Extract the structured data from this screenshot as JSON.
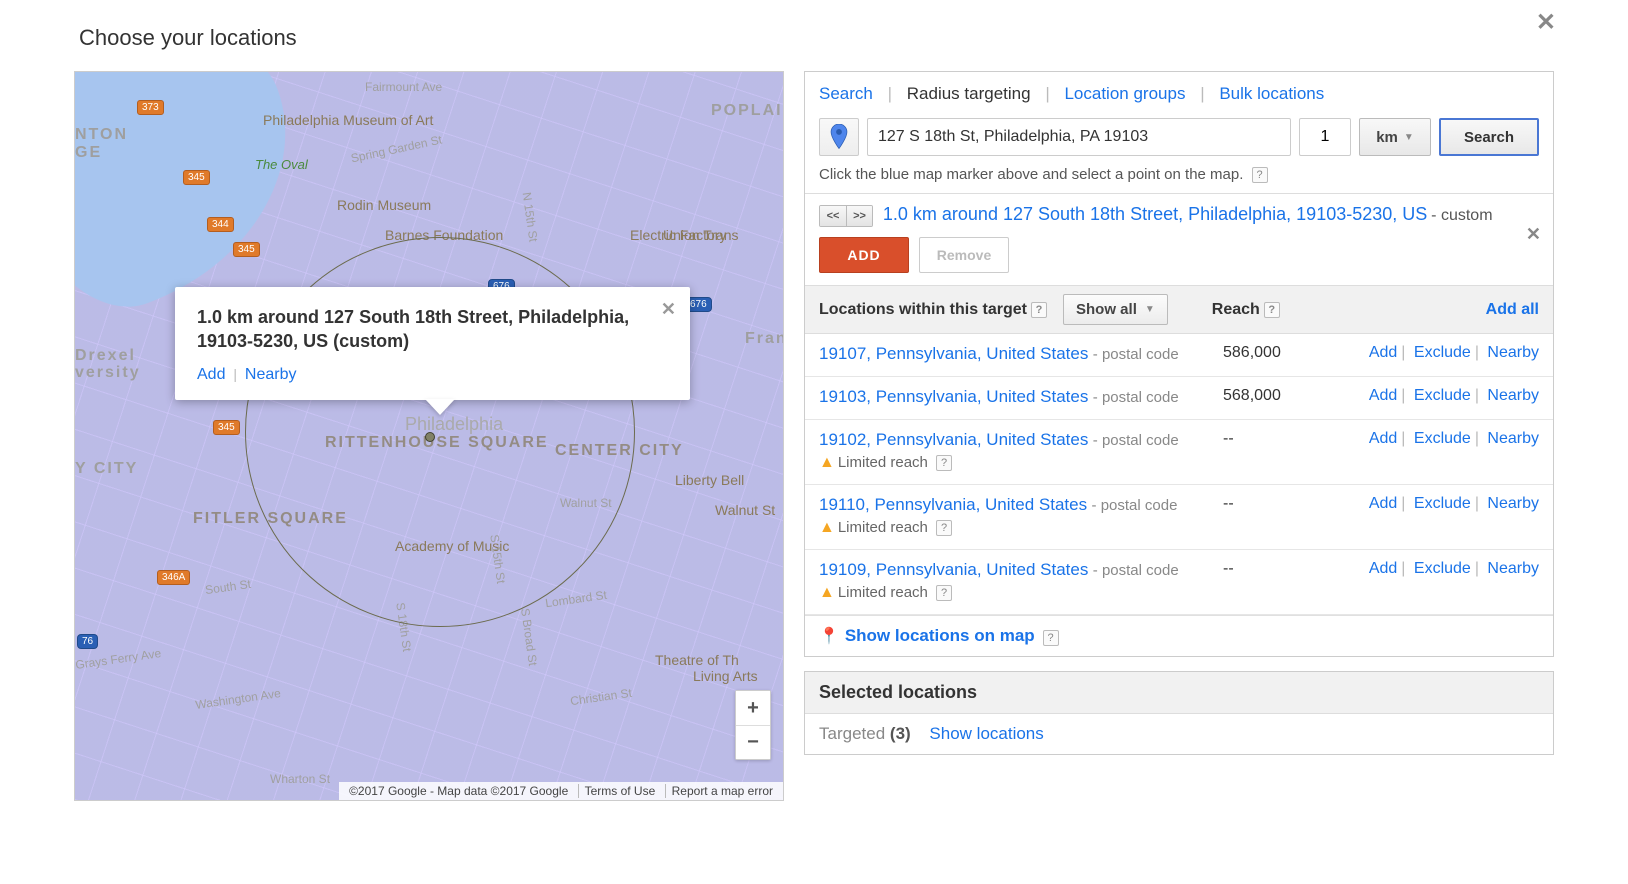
{
  "title": "Choose your locations",
  "tabs": {
    "search": "Search",
    "radius": "Radius targeting",
    "groups": "Location groups",
    "bulk": "Bulk locations"
  },
  "search": {
    "address": "127 S 18th St, Philadelphia, PA 19103",
    "radius": "1",
    "unit": "km",
    "button": "Search",
    "hint": "Click the blue map marker above and select a point on the map."
  },
  "result": {
    "title": "1.0 km around 127 South 18th Street, Philadelphia, 19103-5230, US",
    "suffix": "- custom",
    "add": "ADD",
    "remove": "Remove"
  },
  "locHeader": {
    "label": "Locations within this target",
    "dropdown": "Show all",
    "reach": "Reach",
    "addall": "Add all"
  },
  "actions": {
    "add": "Add",
    "exclude": "Exclude",
    "nearby": "Nearby"
  },
  "limited": "Limited reach",
  "typeLabel": "postal code",
  "locations": [
    {
      "name": "19107, Pennsylvania, United States",
      "reach": "586,000",
      "limited": false
    },
    {
      "name": "19103, Pennsylvania, United States",
      "reach": "568,000",
      "limited": false
    },
    {
      "name": "19102, Pennsylvania, United States",
      "reach": "--",
      "limited": true
    },
    {
      "name": "19110, Pennsylvania, United States",
      "reach": "--",
      "limited": true
    },
    {
      "name": "19109, Pennsylvania, United States",
      "reach": "--",
      "limited": true
    }
  ],
  "showOnMap": "Show locations on map",
  "selected": {
    "header": "Selected locations",
    "targeted": "Targeted",
    "count": "(3)",
    "show": "Show locations"
  },
  "infoWindow": {
    "title": "1.0 km around 127 South 18th Street, Philadelphia, 19103-5230, US (custom)",
    "add": "Add",
    "nearby": "Nearby"
  },
  "mapFooter": {
    "copy": "©2017 Google - Map data ©2017 Google",
    "terms": "Terms of Use",
    "report": "Report a map error"
  },
  "mapLabels": {
    "museum": "Philadelphia Museum of Art",
    "oval": "The Oval",
    "rodin": "Rodin Museum",
    "barnes": "Barnes Foundation",
    "franklin": "The Franklin Institute",
    "rittenhouse": "RITTENHOUSE SQUARE",
    "fitler": "FITLER SQUARE",
    "centercity": "CENTER CITY",
    "poplar": "POPLAI",
    "ycity": "Y CITY",
    "academy": "Academy of Music",
    "liberty": "Liberty Bell",
    "electric": "Electric Factory",
    "walnutst": "Walnut St",
    "theatre": "Theatre of Th",
    "living": "Living Arts",
    "drexel": "Drexel",
    "versity": "versity",
    "franklintown": "Frankl...",
    "ge": "GE",
    "philly": "Philadelphia",
    "uniontr": "Union Trans",
    "springgarden": "Spring Garden St",
    "fairmount": "Fairmount Ave",
    "south": "South St",
    "lombard": "Lombard St",
    "walnut": "Walnut St",
    "christian": "Christian St",
    "washington": "Washington Ave",
    "wharton": "Wharton St",
    "graysferry": "Grays Ferry Ave",
    "broad": "S Broad St",
    "s18": "S 18th St",
    "s15": "S 15th St",
    "n15": "N 15th St"
  }
}
